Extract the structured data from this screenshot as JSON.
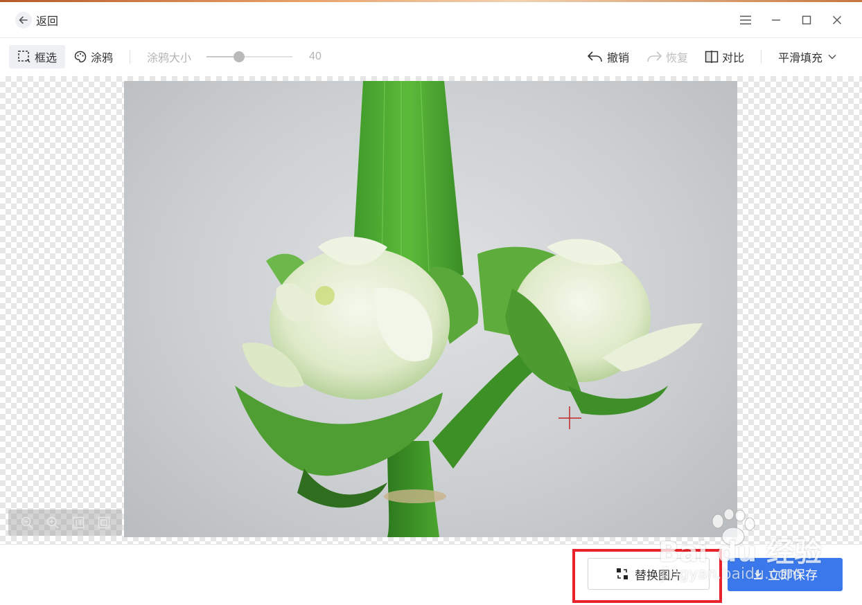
{
  "titlebar": {
    "back_label": "返回"
  },
  "toolbar": {
    "select_label": "框选",
    "brush_label": "涂鸦",
    "brush_size_label": "涂鸦大小",
    "brush_size_value": "40",
    "brush_size_fraction": 0.38,
    "undo_label": "撤销",
    "redo_label": "恢复",
    "compare_label": "对比",
    "fill_mode_label": "平滑填充"
  },
  "canvas": {
    "crosshair_color": "#c0282a"
  },
  "bottom": {
    "replace_label": "替换图片",
    "save_label": "立即保存"
  },
  "watermark": {
    "logo_text": "Bai du 经验",
    "url_text": "jingyan.baidu.com"
  },
  "colors": {
    "accent": "#3a78ec",
    "highlight": "#e8232b"
  }
}
